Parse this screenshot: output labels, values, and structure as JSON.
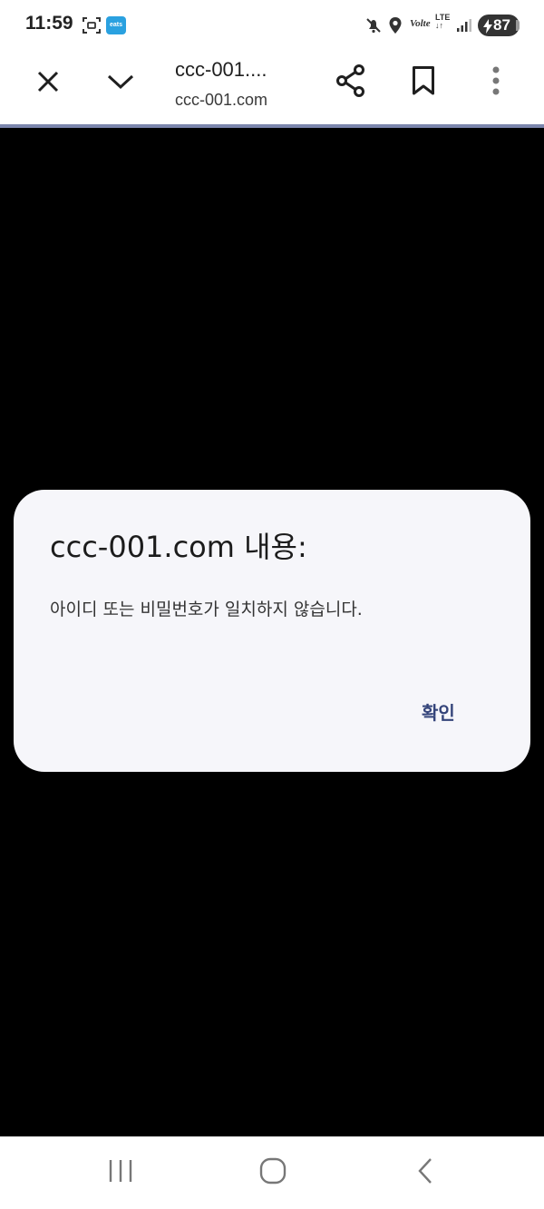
{
  "status_bar": {
    "time": "11:59",
    "app_badge": "eats",
    "volte": "Volte",
    "network": "LTE",
    "battery_percent": "87",
    "icons": [
      "screenshot-icon",
      "eats-app-icon",
      "mute-icon",
      "location-icon",
      "volte-icon",
      "lte-icon",
      "signal-icon",
      "battery-charging-icon"
    ]
  },
  "toolbar": {
    "page_title": "ccc-001....",
    "page_url": "ccc-001.com",
    "icons": [
      "close-icon",
      "chevron-down-icon",
      "share-icon",
      "bookmark-icon",
      "more-vert-icon"
    ]
  },
  "dialog": {
    "title": "ccc-001.com 내용:",
    "message": "아이디 또는 비밀번호가 일치하지 않습니다.",
    "ok_label": "확인"
  },
  "nav_bar": {
    "icons": [
      "recent-apps-icon",
      "home-icon",
      "back-icon"
    ]
  },
  "colors": {
    "dialog_bg": "#f6f6fa",
    "accent": "#34447a",
    "toolbar_underline": "#7c86ad",
    "content_bg": "#000000"
  }
}
